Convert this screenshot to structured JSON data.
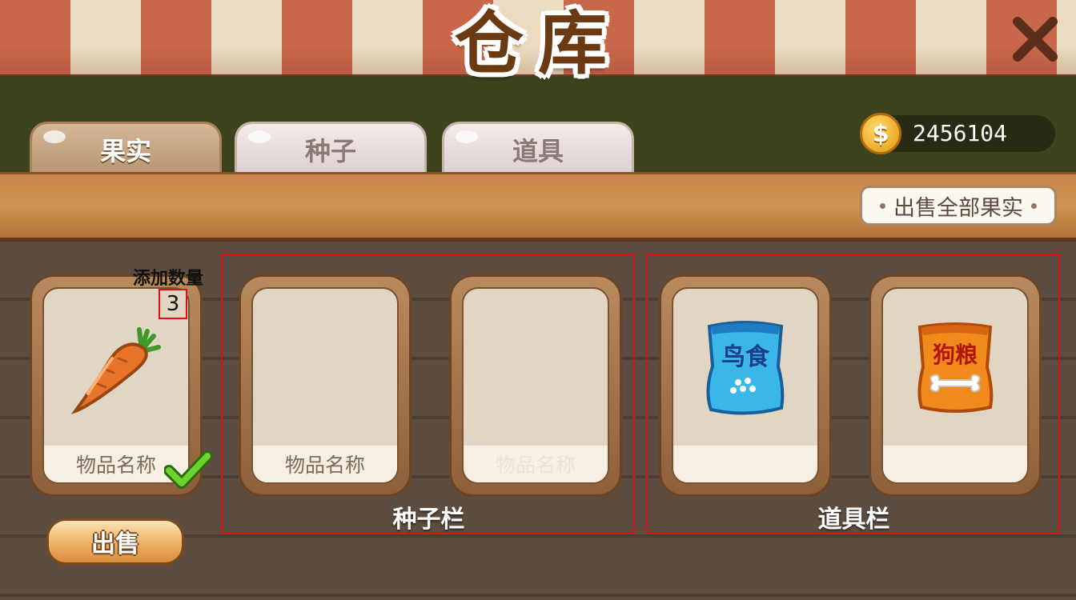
{
  "header": {
    "title": "仓库"
  },
  "tabs": [
    {
      "label": "果实",
      "active": true
    },
    {
      "label": "种子",
      "active": false
    },
    {
      "label": "道具",
      "active": false
    }
  ],
  "coins": {
    "value": "2456104",
    "icon": "coin-icon",
    "symbol": "$"
  },
  "toolbar": {
    "sell_all_label": "出售全部果实"
  },
  "fruit_slot": {
    "add_quantity_label": "添加数量",
    "quantity": "3",
    "item_name": "物品名称",
    "item_icon": "carrot-icon",
    "selected": true,
    "sell_label": "出售"
  },
  "seed_section": {
    "label": "种子栏",
    "cards": [
      {
        "item_name": "物品名称"
      },
      {
        "item_name": "物品名称"
      }
    ]
  },
  "tool_section": {
    "label": "道具栏",
    "cards": [
      {
        "icon": "bird-food-bag-icon",
        "bag_text": "鸟食"
      },
      {
        "icon": "dog-food-bag-icon",
        "bag_text": "狗粮"
      }
    ]
  },
  "colors": {
    "accent_brown": "#6b3a12",
    "highlight_red": "#e01010",
    "check_green": "#58c21e"
  }
}
